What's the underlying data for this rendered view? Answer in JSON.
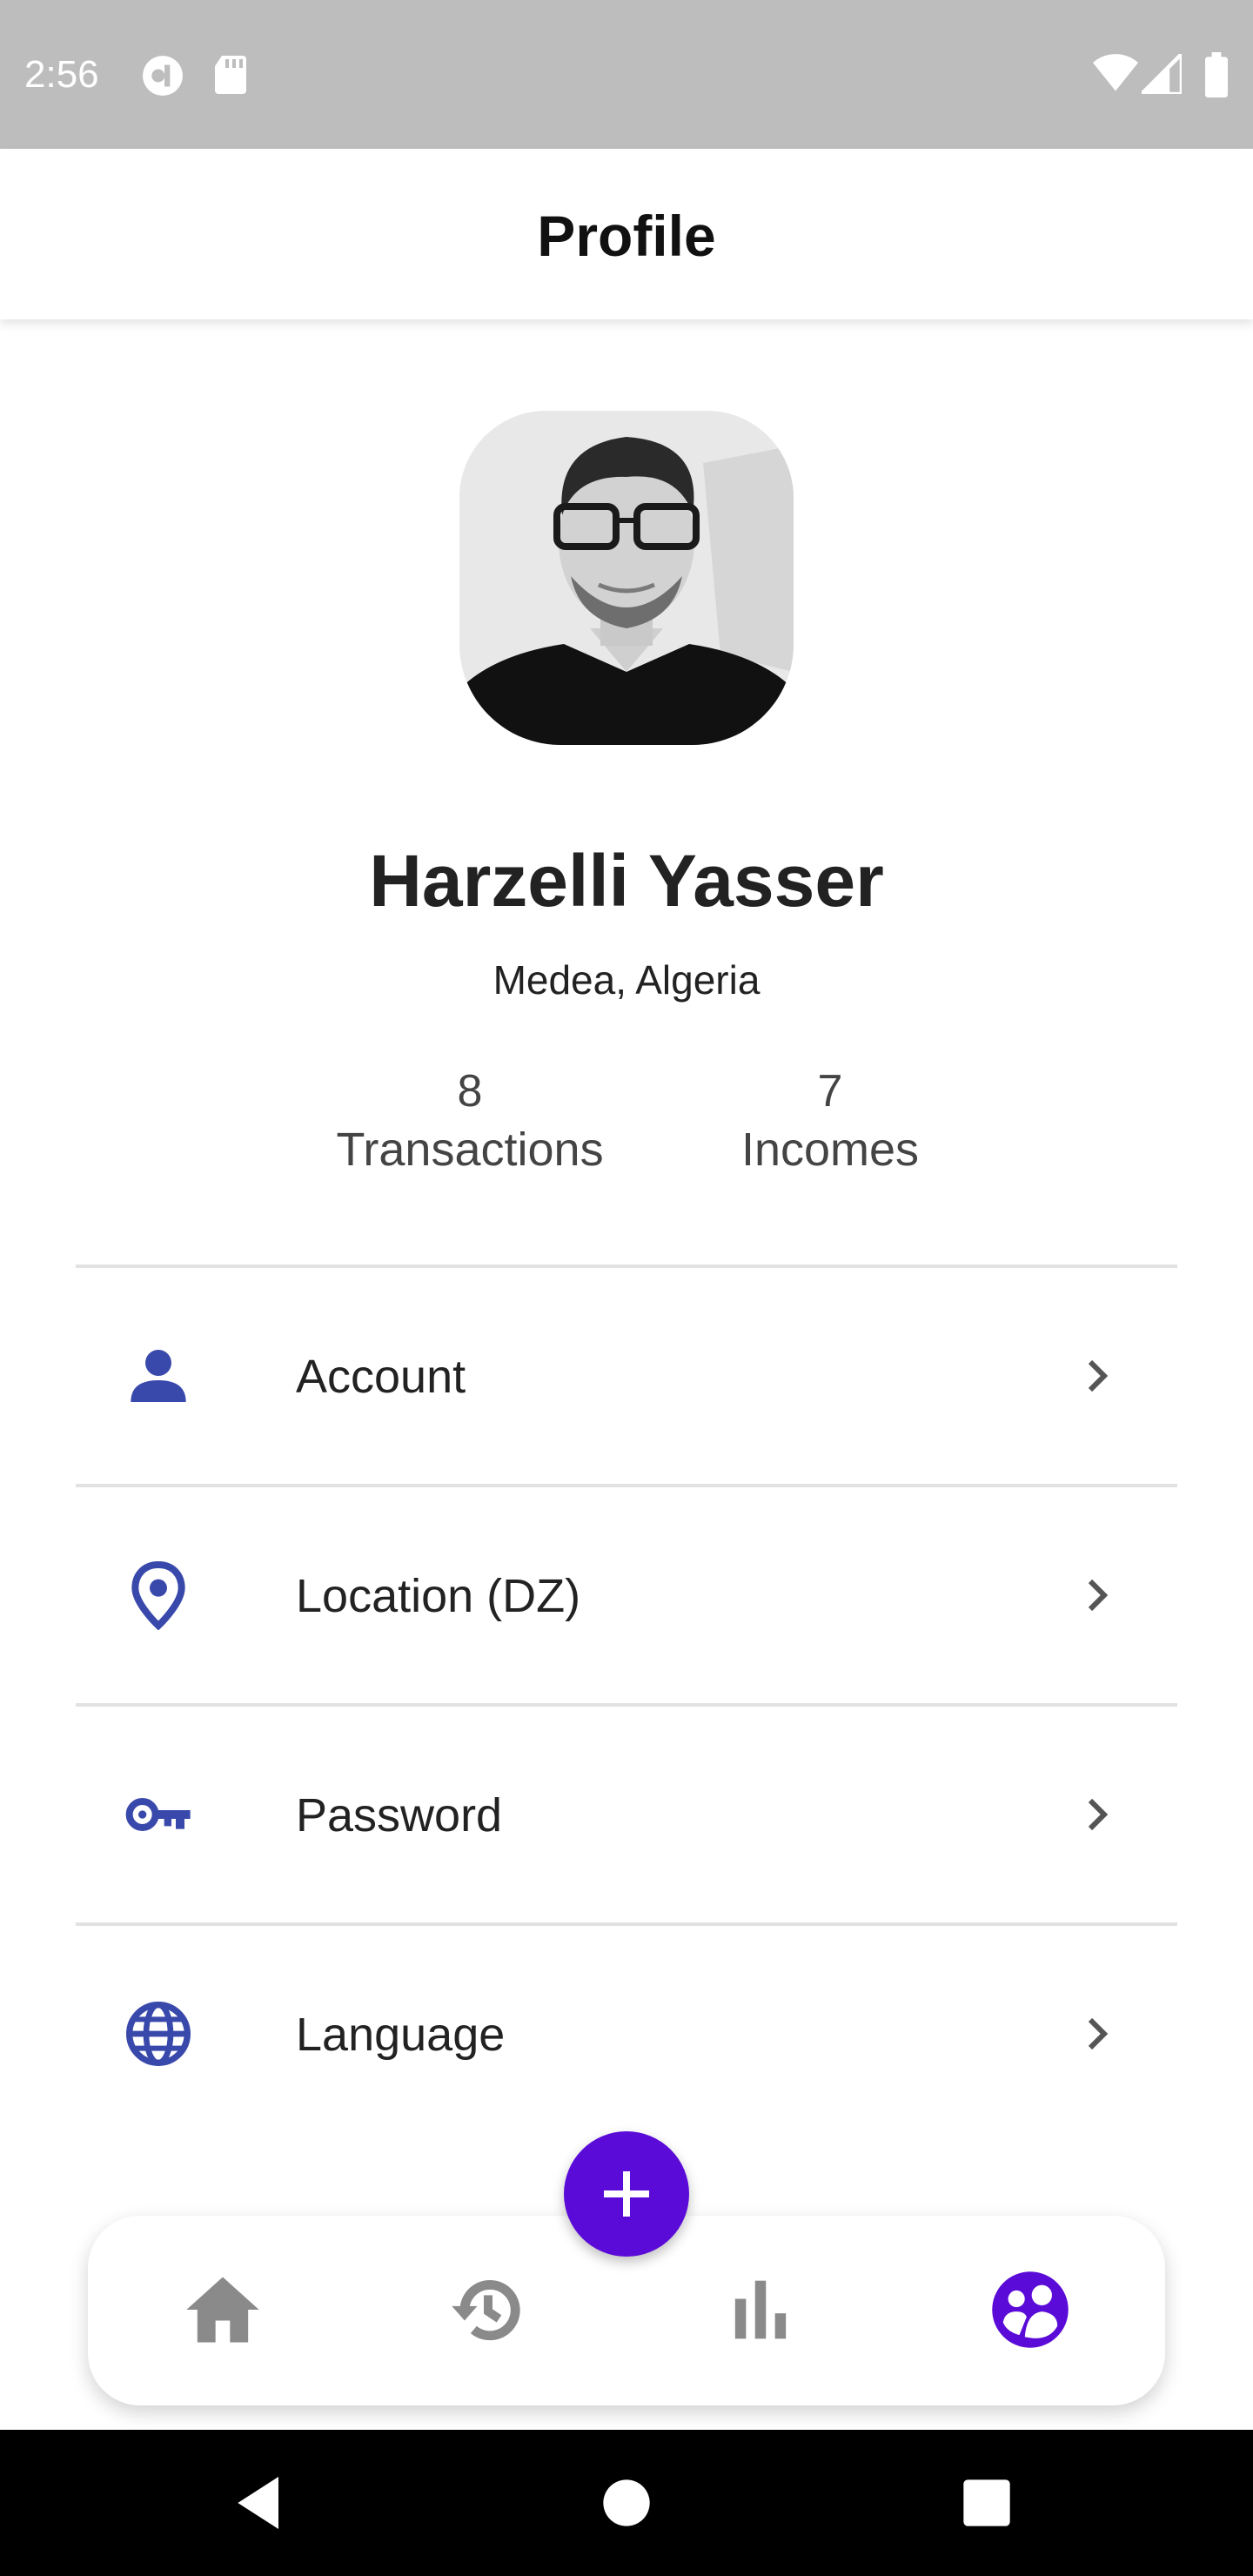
{
  "status_bar": {
    "time": "2:56"
  },
  "header": {
    "title": "Profile"
  },
  "profile": {
    "name": "Harzelli Yasser",
    "location": "Medea, Algeria",
    "stats": [
      {
        "value": "8",
        "label": "Transactions"
      },
      {
        "value": "7",
        "label": "Incomes"
      }
    ]
  },
  "menu": {
    "items": [
      {
        "label": "Account",
        "icon": "person-icon"
      },
      {
        "label": "Location (DZ)",
        "icon": "location-pin-icon"
      },
      {
        "label": "Password",
        "icon": "key-icon"
      },
      {
        "label": "Language",
        "icon": "globe-icon"
      }
    ]
  },
  "bottom_nav": {
    "items": [
      "home-icon",
      "history-icon",
      "bar-chart-icon",
      "profile-icon"
    ],
    "active": "profile-icon",
    "fab_icon": "plus-icon"
  },
  "colors": {
    "accent": "#5b0bd8",
    "menu_icon": "#3949ab",
    "inactive_icon": "#8a8a8a",
    "status_bar": "#bdbdbd"
  }
}
